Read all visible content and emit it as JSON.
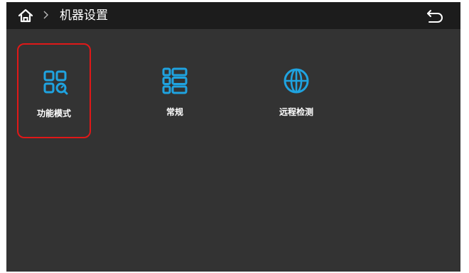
{
  "header": {
    "title": "机器设置",
    "home_icon": "home-icon",
    "breadcrumb_icon": "chevron-right-icon",
    "back_icon": "back-arrow-icon"
  },
  "menu": {
    "items": [
      {
        "label": "功能模式",
        "icon": "function-mode-icon",
        "selected": true
      },
      {
        "label": "常规",
        "icon": "general-list-icon",
        "selected": false
      },
      {
        "label": "远程检测",
        "icon": "globe-icon",
        "selected": false
      }
    ]
  },
  "colors": {
    "accent": "#1fa3e0",
    "selection": "#e01818",
    "background": "#333333",
    "topbar": "#1c1c1c"
  }
}
